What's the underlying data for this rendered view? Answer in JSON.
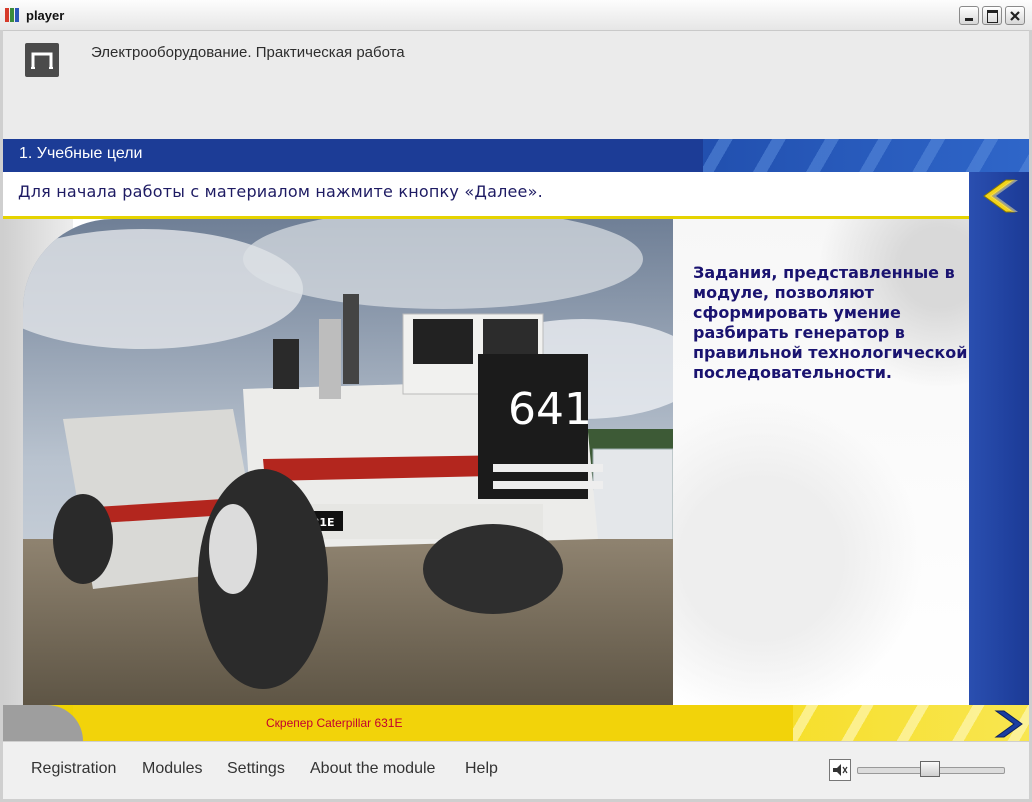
{
  "window": {
    "title": "player"
  },
  "header": {
    "title": "Электрооборудование. Практическая работа",
    "logo_icon": "pi-logo-icon"
  },
  "section": {
    "title": "1. Учебные цели"
  },
  "instruction": {
    "text": "Для начала работы с материалом нажмите кнопку «Далее»."
  },
  "panel": {
    "text": "Задания, представленные в модуле, позволяют сформировать умение разбирать генератор в правильной технологической последовательности."
  },
  "photo": {
    "number_plate": "641",
    "license_plate": "CAT 631E"
  },
  "caption": {
    "text": "Скрепер Caterpillar 631E"
  },
  "footer": {
    "menu": [
      "Registration",
      "Modules",
      "Settings",
      "About the module",
      "Help"
    ],
    "volume_level": 0.5
  },
  "colors": {
    "section_blue": "#1c3c96",
    "accent_yellow": "#f2d30a",
    "text_navy": "#1a1370",
    "caption_red": "#c2002f"
  }
}
